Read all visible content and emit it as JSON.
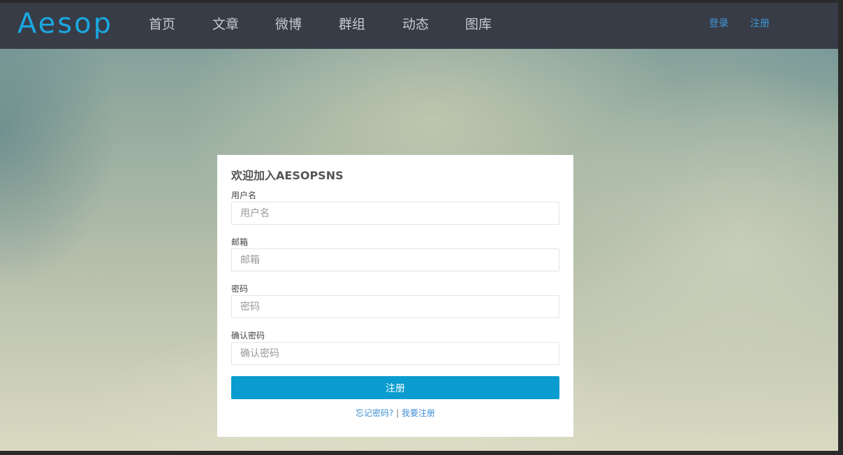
{
  "brand": {
    "logo_text": "Aesop"
  },
  "nav": {
    "items": [
      "首页",
      "文章",
      "微博",
      "群组",
      "动态",
      "图库"
    ],
    "login": "登录",
    "register": "注册"
  },
  "form": {
    "title": "欢迎加入AESOPSNS",
    "fields": [
      {
        "label": "用户名",
        "placeholder": "用户名",
        "value": ""
      },
      {
        "label": "邮箱",
        "placeholder": "邮箱",
        "value": ""
      },
      {
        "label": "密码",
        "placeholder": "密码",
        "value": ""
      },
      {
        "label": "确认密码",
        "placeholder": "确认密码",
        "value": ""
      }
    ],
    "submit_label": "注册",
    "forgot_link": "忘记密码?",
    "separator": " | ",
    "register_link": "我要注册"
  },
  "colors": {
    "navbar": "#373c47",
    "logo": "#1aa8e0",
    "link": "#3f97d6",
    "primary_button": "#0a9ccf"
  }
}
